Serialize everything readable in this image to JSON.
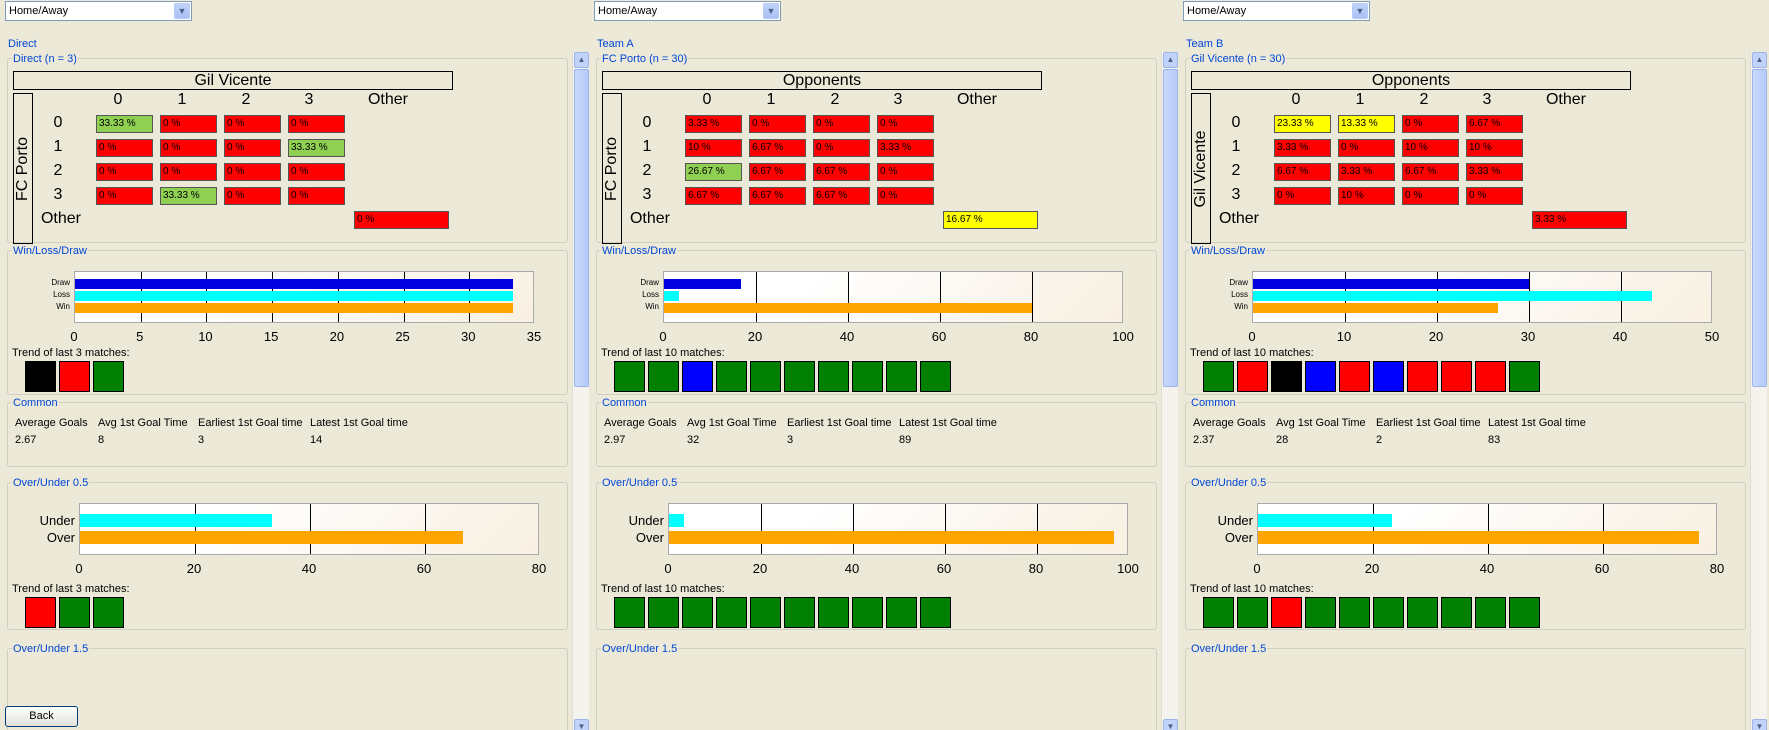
{
  "panels": [
    {
      "select": "Home/Away",
      "title": "Direct",
      "group": "Direct (n = 3)",
      "col_team": "Gil Vicente",
      "row_team": "FC Porto",
      "col_heads": [
        "0",
        "1",
        "2",
        "3",
        "Other"
      ],
      "row_heads": [
        "0",
        "1",
        "2",
        "3",
        "Other"
      ],
      "matrix": [
        [
          "33.33 %",
          "0 %",
          "0 %",
          "0 %"
        ],
        [
          "0 %",
          "0 %",
          "0 %",
          "33.33 %"
        ],
        [
          "0 %",
          "0 %",
          "0 %",
          "0 %"
        ],
        [
          "0 %",
          "33.33 %",
          "0 %",
          "0 %"
        ]
      ],
      "matrix_colors": [
        [
          "grn",
          "red",
          "red",
          "red"
        ],
        [
          "red",
          "red",
          "red",
          "grn"
        ],
        [
          "red",
          "red",
          "red",
          "red"
        ],
        [
          "red",
          "grn",
          "red",
          "red"
        ]
      ],
      "other": "0 %",
      "other_color": "red",
      "wld_caption": "Win/Loss/Draw",
      "wld_labels": [
        "Draw",
        "Loss",
        "Win"
      ],
      "wld_values": [
        33.33,
        33.33,
        33.33
      ],
      "wld_ticks": [
        "0",
        "5",
        "10",
        "15",
        "20",
        "25",
        "30",
        "35"
      ],
      "wld_max": 35,
      "trend1_label": "Trend of last 3 matches:",
      "trend1": [
        "#000000",
        "#ff0000",
        "#008000"
      ],
      "common_caption": "Common",
      "common_heads": [
        "Average Goals",
        "Avg 1st Goal Time",
        "Earliest 1st Goal time",
        "Latest 1st Goal time"
      ],
      "common_vals": [
        "2.67",
        "8",
        "3",
        "14"
      ],
      "ou_caption": "Over/Under 0.5",
      "ou_labels": [
        "Under",
        "Over"
      ],
      "ou_values": [
        33.33,
        66.67
      ],
      "ou_ticks": [
        "0",
        "20",
        "40",
        "60",
        "80"
      ],
      "ou_max": 80,
      "trend2_label": "Trend of last 3 matches:",
      "trend2": [
        "#ff0000",
        "#008000",
        "#008000"
      ],
      "ou15_caption": "Over/Under 1.5"
    },
    {
      "select": "Home/Away",
      "title": "Team A",
      "group": "FC Porto (n = 30)",
      "col_team": "Opponents",
      "row_team": "FC Porto",
      "col_heads": [
        "0",
        "1",
        "2",
        "3",
        "Other"
      ],
      "row_heads": [
        "0",
        "1",
        "2",
        "3",
        "Other"
      ],
      "matrix": [
        [
          "3.33 %",
          "0 %",
          "0 %",
          "0 %"
        ],
        [
          "10 %",
          "6.67 %",
          "0 %",
          "3.33 %"
        ],
        [
          "26.67 %",
          "6.67 %",
          "6.67 %",
          "0 %"
        ],
        [
          "6.67 %",
          "6.67 %",
          "6.67 %",
          "0 %"
        ]
      ],
      "matrix_colors": [
        [
          "red",
          "red",
          "red",
          "red"
        ],
        [
          "red",
          "red",
          "red",
          "red"
        ],
        [
          "grn",
          "red",
          "red",
          "red"
        ],
        [
          "red",
          "red",
          "red",
          "red"
        ]
      ],
      "other": "16.67 %",
      "other_color": "yel",
      "wld_caption": "Win/Loss/Draw",
      "wld_labels": [
        "Draw",
        "Loss",
        "Win"
      ],
      "wld_values": [
        16.67,
        3.33,
        80
      ],
      "wld_ticks": [
        "0",
        "20",
        "40",
        "60",
        "80",
        "100"
      ],
      "wld_max": 100,
      "trend1_label": "Trend of last 10 matches:",
      "trend1": [
        "#008000",
        "#008000",
        "#0000ff",
        "#008000",
        "#008000",
        "#008000",
        "#008000",
        "#008000",
        "#008000",
        "#008000"
      ],
      "common_caption": "Common",
      "common_heads": [
        "Average Goals",
        "Avg 1st Goal Time",
        "Earliest 1st Goal time",
        "Latest 1st Goal time"
      ],
      "common_vals": [
        "2.97",
        "32",
        "3",
        "89"
      ],
      "ou_caption": "Over/Under 0.5",
      "ou_labels": [
        "Under",
        "Over"
      ],
      "ou_values": [
        3.33,
        96.67
      ],
      "ou_ticks": [
        "0",
        "20",
        "40",
        "60",
        "80",
        "100"
      ],
      "ou_max": 100,
      "trend2_label": "Trend of last 10 matches:",
      "trend2": [
        "#008000",
        "#008000",
        "#008000",
        "#008000",
        "#008000",
        "#008000",
        "#008000",
        "#008000",
        "#008000",
        "#008000"
      ],
      "ou15_caption": "Over/Under 1.5"
    },
    {
      "select": "Home/Away",
      "title": "Team B",
      "group": "Gil Vicente (n = 30)",
      "col_team": "Opponents",
      "row_team": "Gil Vicente",
      "col_heads": [
        "0",
        "1",
        "2",
        "3",
        "Other"
      ],
      "row_heads": [
        "0",
        "1",
        "2",
        "3",
        "Other"
      ],
      "matrix": [
        [
          "23.33 %",
          "13.33 %",
          "0 %",
          "6.67 %"
        ],
        [
          "3.33 %",
          "0 %",
          "10 %",
          "10 %"
        ],
        [
          "6.67 %",
          "3.33 %",
          "6.67 %",
          "3.33 %"
        ],
        [
          "0 %",
          "10 %",
          "0 %",
          "0 %"
        ]
      ],
      "matrix_colors": [
        [
          "yel",
          "yel",
          "red",
          "red"
        ],
        [
          "red",
          "red",
          "red",
          "red"
        ],
        [
          "red",
          "red",
          "red",
          "red"
        ],
        [
          "red",
          "red",
          "red",
          "red"
        ]
      ],
      "other": "3.33 %",
      "other_color": "red",
      "wld_caption": "Win/Loss/Draw",
      "wld_labels": [
        "Draw",
        "Loss",
        "Win"
      ],
      "wld_values": [
        30,
        43.33,
        26.67
      ],
      "wld_ticks": [
        "0",
        "10",
        "20",
        "30",
        "40",
        "50"
      ],
      "wld_max": 50,
      "trend1_label": "Trend of last 10 matches:",
      "trend1": [
        "#008000",
        "#ff0000",
        "#000000",
        "#0000ff",
        "#ff0000",
        "#0000ff",
        "#ff0000",
        "#ff0000",
        "#ff0000",
        "#008000"
      ],
      "common_caption": "Common",
      "common_heads": [
        "Average Goals",
        "Avg 1st Goal Time",
        "Earliest 1st Goal time",
        "Latest 1st Goal time"
      ],
      "common_vals": [
        "2.37",
        "28",
        "2",
        "83"
      ],
      "ou_caption": "Over/Under 0.5",
      "ou_labels": [
        "Under",
        "Over"
      ],
      "ou_values": [
        23.33,
        76.67
      ],
      "ou_ticks": [
        "0",
        "20",
        "40",
        "60",
        "80"
      ],
      "ou_max": 80,
      "trend2_label": "Trend of last 10 matches:",
      "trend2": [
        "#008000",
        "#008000",
        "#ff0000",
        "#008000",
        "#008000",
        "#008000",
        "#008000",
        "#008000",
        "#008000",
        "#008000"
      ],
      "ou15_caption": "Over/Under 1.5"
    }
  ],
  "bar_colors": {
    "draw": "#0000e0",
    "loss": "#00ffff",
    "win": "#ffa500",
    "under": "#00ffff",
    "over": "#ffa500"
  },
  "back_label": "Back"
}
